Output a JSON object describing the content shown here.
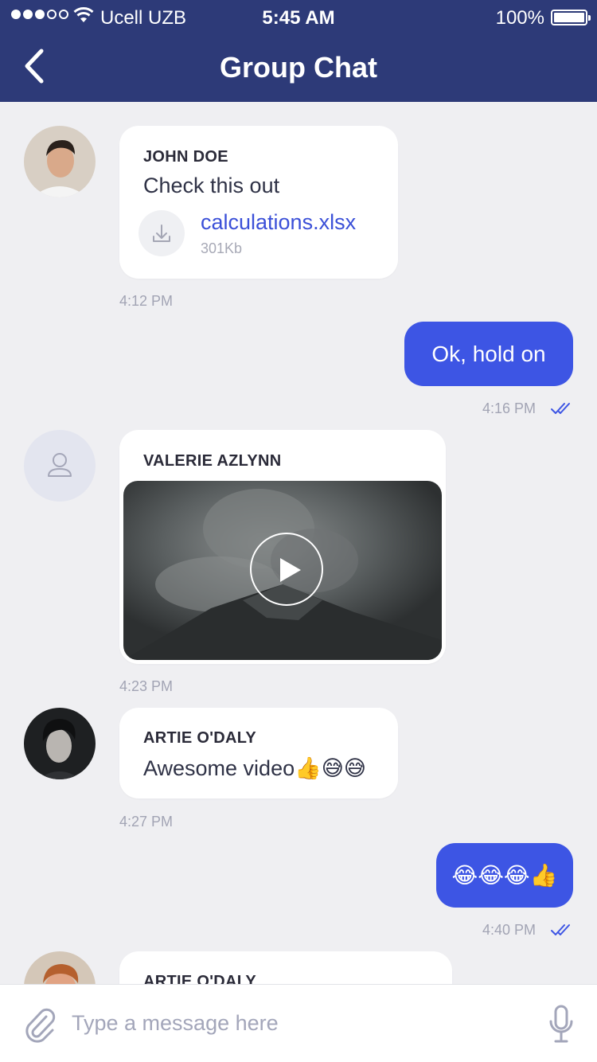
{
  "status_bar": {
    "carrier": "Ucell UZB",
    "time": "5:45 AM",
    "battery": "100%"
  },
  "header": {
    "title": "Group Chat"
  },
  "messages": [
    {
      "sender": "JOHN DOE",
      "text": "Check this out",
      "file": {
        "name": "calculations.xlsx",
        "size": "301Kb"
      },
      "time": "4:12 PM"
    },
    {
      "text": "Ok, hold on",
      "time": "4:16 PM"
    },
    {
      "sender": "VALERIE AZLYNN",
      "time": "4:23 PM"
    },
    {
      "sender": "ARTIE O'DALY",
      "text": "Awesome video👍😅😅",
      "time": "4:27 PM"
    },
    {
      "text": "😂😂😂👍",
      "time": "4:40 PM"
    },
    {
      "sender": "ARTIE O'DALY"
    }
  ],
  "composer": {
    "placeholder": "Type a message here"
  },
  "colors": {
    "header": "#2d3a78",
    "outgoing": "#3d55e4",
    "background": "#efeff2"
  }
}
